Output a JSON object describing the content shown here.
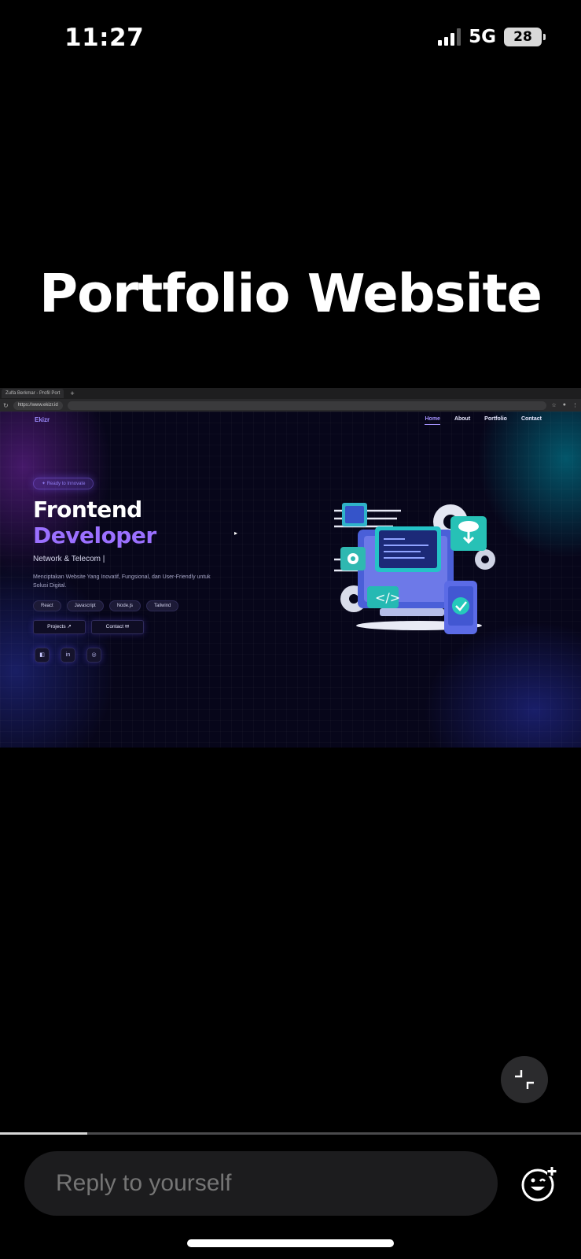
{
  "status_bar": {
    "time": "11:27",
    "network": "5G",
    "battery": "28"
  },
  "headline": "Portfolio Website",
  "video": {
    "browser": {
      "tab_title": "Zulfa Berkmar - Profil Port",
      "url": "https://www.ekizr.id"
    },
    "site": {
      "logo": "Ekizr",
      "nav": [
        "Home",
        "About",
        "Portfolio",
        "Contact"
      ],
      "badge": "Ready to Innovate",
      "title_line1": "Frontend",
      "title_line2": "Developer",
      "subtitle": "Network & Telecom |",
      "description": "Menciptakan Website Yang Inovatif, Fungsional, dan User-Friendly untuk Solusi Digital.",
      "tags": [
        "React",
        "Javascript",
        "Node.js",
        "Tailwind"
      ],
      "buttons": {
        "projects": "Projects ↗",
        "contact": "Contact ✉"
      },
      "socials": [
        "github-icon",
        "linkedin-icon",
        "instagram-icon"
      ]
    }
  },
  "progress": 0.15,
  "composer": {
    "placeholder": "Reply to yourself"
  },
  "colors": {
    "accent": "#9b70ff",
    "background": "#000000"
  }
}
